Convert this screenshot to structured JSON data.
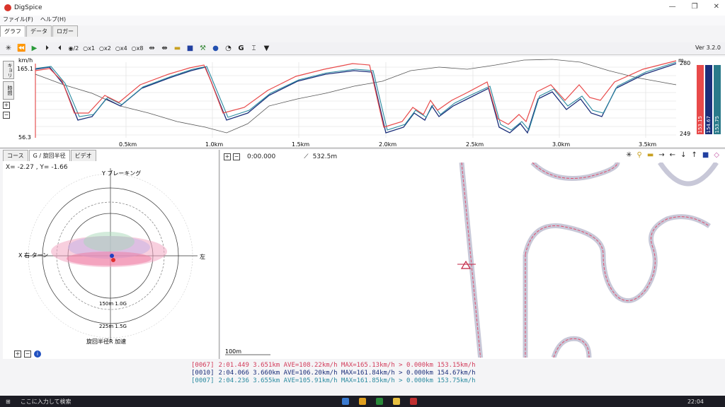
{
  "window": {
    "title": "DigSpice"
  },
  "menu": [
    "ファイル(F)",
    "ヘルプ(H)"
  ],
  "tabs": [
    "グラフ",
    "データ",
    "ロガー"
  ],
  "toolbar": {
    "speed_options": [
      "/2",
      "x1",
      "x2",
      "x4",
      "x8"
    ],
    "version": "Ver 3.2.0"
  },
  "graph": {
    "y_unit_left": "km/h",
    "y_max_label": "165.1",
    "y_min_label": "56.3",
    "y_unit_right": "m",
    "y_right_max": "280",
    "y_right_min": "249",
    "x_ticks": [
      "0.5km",
      "1.0km",
      "1.5km",
      "2.0km",
      "2.5km",
      "3.0km",
      "3.5km"
    ],
    "side_tabs": [
      "キョリ",
      "時間"
    ]
  },
  "legend_bars": [
    {
      "value": "153.15",
      "color": "#e84a4a"
    },
    {
      "value": "154.67",
      "color": "#1a2e7a"
    },
    {
      "value": "153.75",
      "color": "#2a7a8a"
    }
  ],
  "lower_tabs": [
    "コース",
    "G / 旋回半径",
    "ビデオ"
  ],
  "gplot": {
    "coords": "X= -2.27 , Y= -1.66",
    "y_label": "Y ブレーキング",
    "x_left": "X 右 ターン",
    "x_right": "左",
    "ring1": "150m 1.0G",
    "ring2": "225m 1.5G",
    "bottom_label": "旋回半径R 加速"
  },
  "map": {
    "time": "0:00.000",
    "distance": "532.5m",
    "scale": "100m"
  },
  "laps": [
    {
      "id": "[0067]",
      "text": "2:01.449 3.651km AVE=108.22km/h MAX=165.13km/h > 0.000km 153.15km/h",
      "color": "#d23b5a"
    },
    {
      "id": "[0010]",
      "text": "2:04.066 3.660km AVE=106.20km/h MAX=161.84km/h > 0.000km 154.67km/h",
      "color": "#1a2e7a"
    },
    {
      "id": "[0007]",
      "text": "2:04.236 3.655km AVE=105.91km/h MAX=161.85km/h > 0.000km 153.75km/h",
      "color": "#2a8aa0"
    }
  ],
  "taskbar": {
    "search": "ここに入力して検索",
    "time": "22:04"
  }
}
